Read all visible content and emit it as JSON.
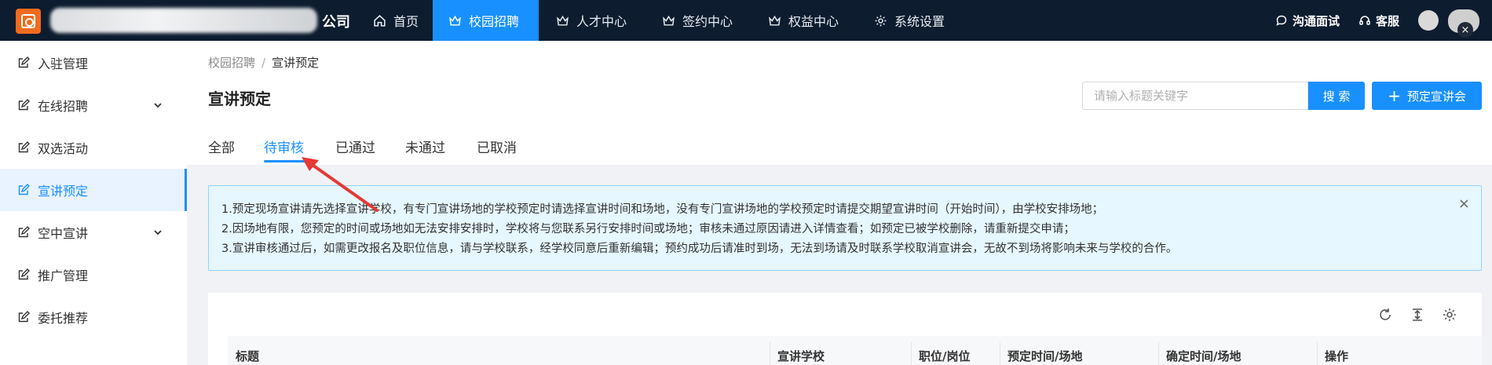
{
  "topbar": {
    "company_suffix": "公司",
    "nav": [
      {
        "label": "首页",
        "icon": "home-icon"
      },
      {
        "label": "校园招聘",
        "icon": "crown-icon",
        "active": true
      },
      {
        "label": "人才中心",
        "icon": "crown-icon"
      },
      {
        "label": "签约中心",
        "icon": "crown-icon"
      },
      {
        "label": "权益中心",
        "icon": "crown-icon"
      },
      {
        "label": "系统设置",
        "icon": "gear-icon"
      }
    ],
    "interview_label": "沟通面试",
    "service_label": "客服"
  },
  "sidebar": {
    "items": [
      {
        "label": "入驻管理"
      },
      {
        "label": "在线招聘",
        "expandable": true
      },
      {
        "label": "双选活动"
      },
      {
        "label": "宣讲预定",
        "active": true
      },
      {
        "label": "空中宣讲",
        "expandable": true
      },
      {
        "label": "推广管理"
      },
      {
        "label": "委托推荐"
      }
    ]
  },
  "breadcrumb": {
    "parent": "校园招聘",
    "separator": "/",
    "current": "宣讲预定"
  },
  "page_title": "宣讲预定",
  "search": {
    "placeholder": "请输入标题关键字",
    "button_label": "搜 索"
  },
  "add_button_label": "预定宣讲会",
  "tabs": [
    {
      "label": "全部"
    },
    {
      "label": "待审核",
      "active": true
    },
    {
      "label": "已通过"
    },
    {
      "label": "未通过"
    },
    {
      "label": "已取消"
    }
  ],
  "notice": {
    "lines": [
      "1.预定现场宣讲请先选择宣讲学校，有专门宣讲场地的学校预定时请选择宣讲时间和场地，没有专门宣讲场地的学校预定时请提交期望宣讲时间（开始时间），由学校安排场地；",
      "2.因场地有限，您预定的时间或场地如无法安排安排时，学校将与您联系另行安排时间或场地；审核未通过原因请进入详情查看；如预定已被学校删除，请重新提交申请；",
      "3.宣讲审核通过后，如需更改报名及职位信息，请与学校联系，经学校同意后重新编辑；预约成功后请准时到场，无法到场请及时联系学校取消宣讲会，无故不到场将影响未来与学校的合作。"
    ],
    "close_symbol": "×"
  },
  "table": {
    "columns": [
      "标题",
      "宣讲学校",
      "职位/岗位",
      "预定时间/场地",
      "确定时间/场地",
      "操作"
    ]
  },
  "colors": {
    "topbar_bg": "#0d1c2f",
    "accent": "#1890ff",
    "notice_bg": "#e6f7ff",
    "notice_border": "#91d5ff"
  }
}
